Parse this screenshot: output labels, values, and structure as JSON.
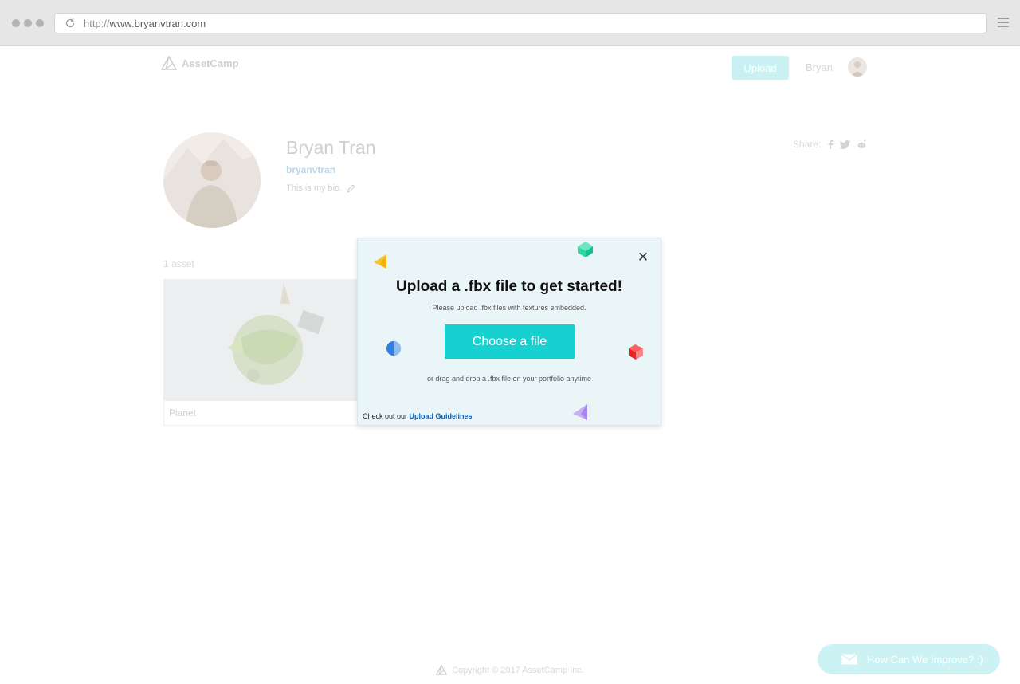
{
  "browser": {
    "url_scheme": "http://",
    "url_host": "www.bryanvtran.com"
  },
  "nav": {
    "logo_text": "AssetCamp",
    "upload_label": "Upload",
    "user_name": "Bryan"
  },
  "profile": {
    "name": "Bryan Tran",
    "handle": "bryanvtran",
    "bio": "This is my bio.",
    "share_label": "Share:"
  },
  "assets": {
    "count_label": "1 asset",
    "items": [
      {
        "title": "Planet"
      }
    ]
  },
  "modal": {
    "title": "Upload a .fbx file to get started!",
    "subtitle": "Please upload .fbx files with textures embedded.",
    "choose_label": "Choose a file",
    "drag_text": "or drag and drop a .fbx file on your portfolio anytime",
    "guide_prefix": "Check out our",
    "guide_link": "Upload Guidelines",
    "close_glyph": "✕"
  },
  "footer": {
    "copyright": "Copyright © 2017 AssetCamp Inc."
  },
  "feedback": {
    "label": "How Can We Improve? :)"
  },
  "colors": {
    "accent": "#17d1d1",
    "modal_bg": "#eaf5f8",
    "link": "#0e5ea8"
  }
}
